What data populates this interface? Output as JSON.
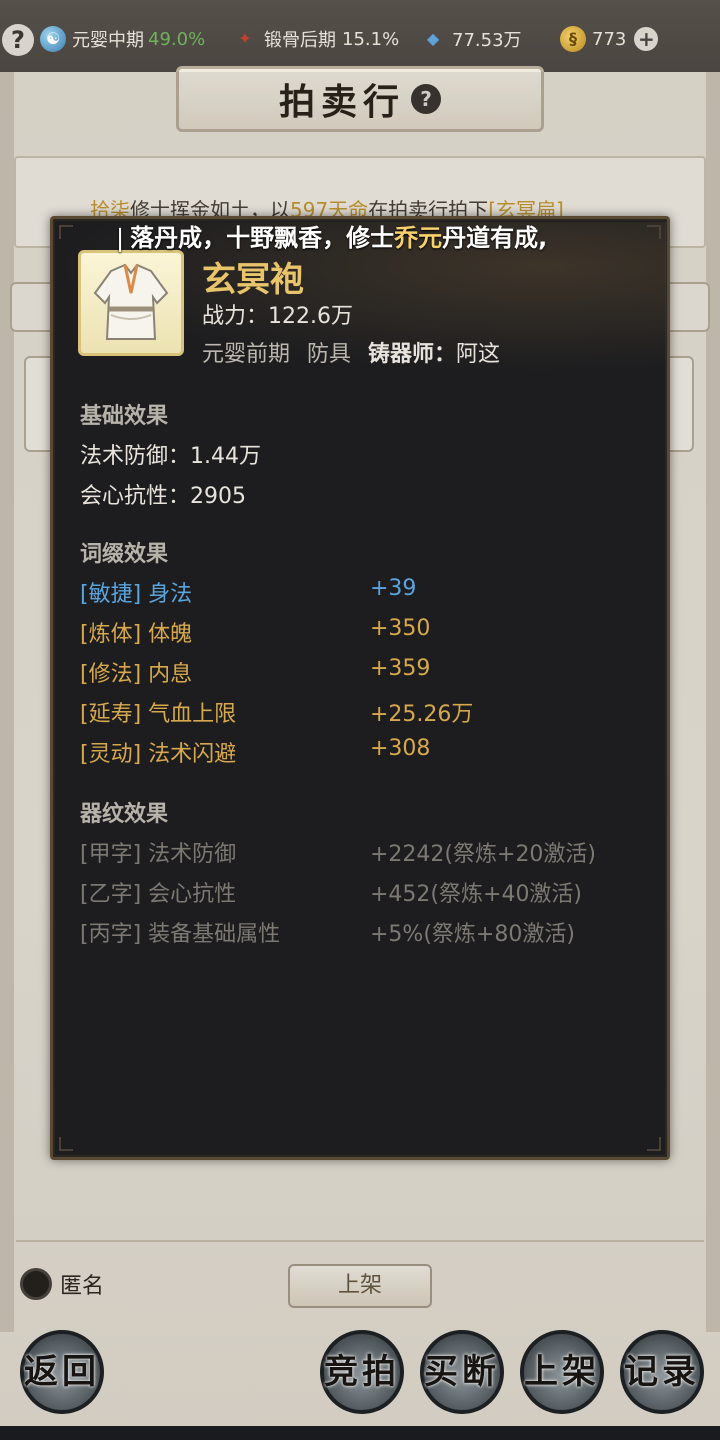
{
  "topbar": {
    "help": "?",
    "realm1": {
      "label": "元婴中期",
      "pct": "49.0%"
    },
    "realm2": {
      "label": "锻骨后期",
      "pct": "15.1%"
    },
    "stone": {
      "value": "77.53万"
    },
    "coin": {
      "value": "773"
    },
    "plus": "+"
  },
  "title": {
    "text": "拍卖行",
    "help": "?"
  },
  "ticker_behind": {
    "prefix": "拾柒",
    "middle1": "修士挥金如土，以",
    "amount": "597天命",
    "middle2": "在拍卖行拍下",
    "item": "[玄冥扁]"
  },
  "broadcast": {
    "part1": "❘落丹成，十野飘香，修士",
    "name": "乔元",
    "part2": "丹道有成,"
  },
  "item": {
    "name": "玄冥袍",
    "power": "战力：122.6万",
    "realm": "元婴前期",
    "type": "防具",
    "smith_label": "铸器师：",
    "smith": "阿这"
  },
  "base": {
    "title": "基础效果",
    "rows": [
      {
        "k": "法术防御：",
        "v": "1.44万"
      },
      {
        "k": "会心抗性：",
        "v": "2905"
      }
    ]
  },
  "affix": {
    "title": "词缀效果",
    "rows": [
      {
        "tag": "[敏捷]",
        "name": "身法",
        "v": "+39",
        "color": "#5aa5dd"
      },
      {
        "tag": "[炼体]",
        "name": "体魄",
        "v": "+350",
        "color": "#d8a94c"
      },
      {
        "tag": "[修法]",
        "name": "内息",
        "v": "+359",
        "color": "#d8a94c"
      },
      {
        "tag": "[延寿]",
        "name": "气血上限",
        "v": "+25.26万",
        "color": "#d8a94c"
      },
      {
        "tag": "[灵动]",
        "name": "法术闪避",
        "v": "+308",
        "color": "#d8a94c"
      }
    ]
  },
  "pattern": {
    "title": "器纹效果",
    "rows": [
      {
        "tag": "[甲字]",
        "name": "法术防御",
        "v": "+2242(祭炼+20激活)"
      },
      {
        "tag": "[乙字]",
        "name": "会心抗性",
        "v": "+452(祭炼+40激活)"
      },
      {
        "tag": "[丙字]",
        "name": "装备基础属性",
        "v": "+5%(祭炼+80激活)"
      }
    ]
  },
  "bottom": {
    "anon": "匿名",
    "shelf": "上架",
    "back": "返回",
    "bid": "竞拍",
    "buyout": "买断",
    "list": "上架",
    "records": "记录"
  }
}
